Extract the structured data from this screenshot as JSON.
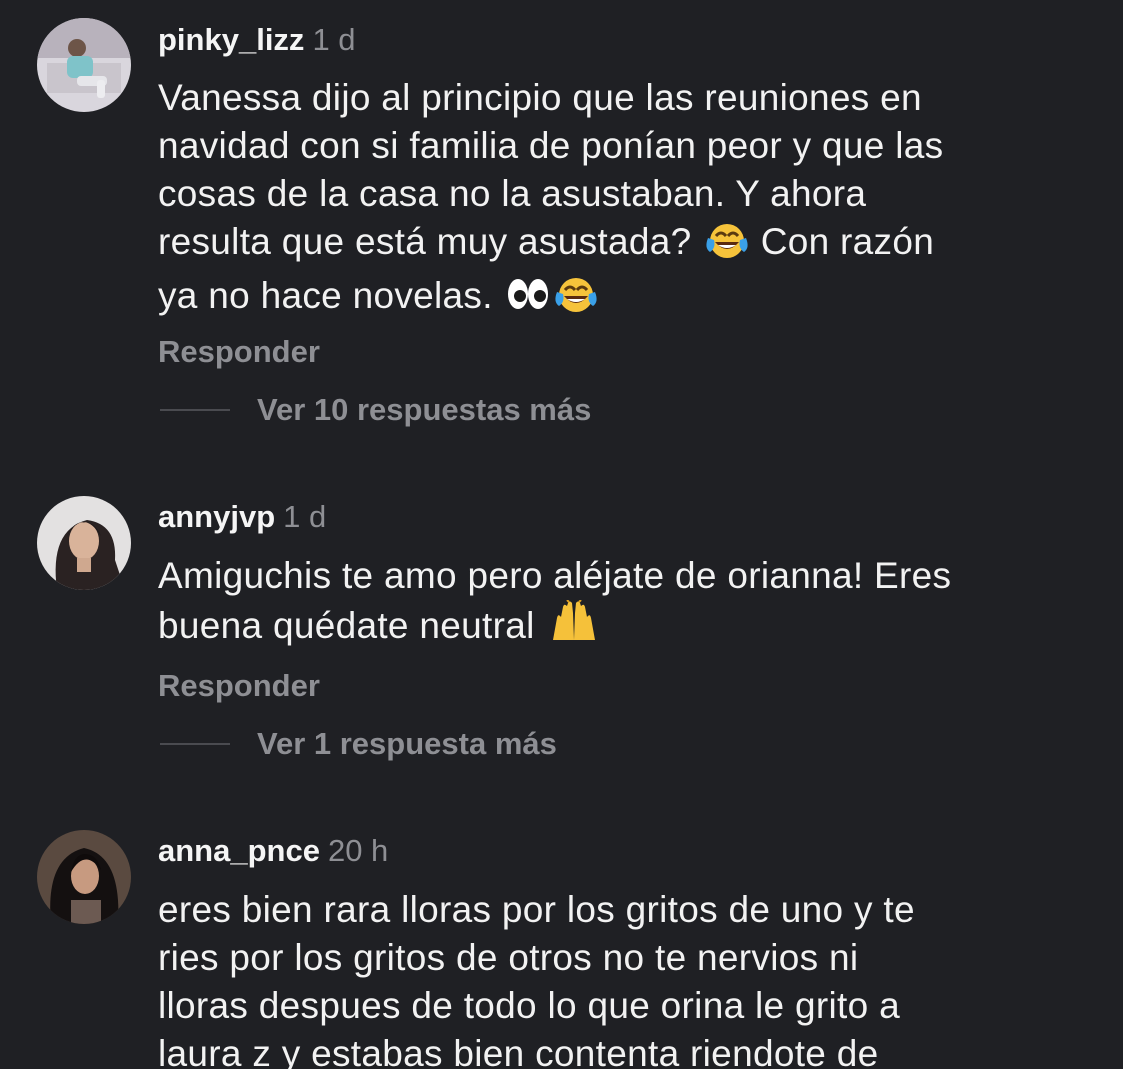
{
  "comments": [
    {
      "username": "pinky_lizz",
      "time": "1 d",
      "lines": [
        "Vanessa dijo al principio que las reuniones en",
        "navidad con si familia de ponían peor y que las",
        "cosas de la casa no la asustaban. Y ahora",
        "resulta que está muy asustada?",
        "Con razón",
        "ya no hace novelas."
      ],
      "reply_label": "Responder",
      "more_replies": "Ver 10 respuestas más"
    },
    {
      "username": "annyjvp",
      "time": "1 d",
      "lines": [
        "Amiguchis te amo pero aléjate de orianna! Eres",
        "buena quédate neutral"
      ],
      "reply_label": "Responder",
      "more_replies": "Ver 1 respuesta más"
    },
    {
      "username": "anna_pnce",
      "time": "20 h",
      "lines": [
        "eres bien rara lloras por los gritos de uno y te",
        "ries por los gritos de otros no te nervios ni",
        "lloras despues de todo lo que orina le grito a",
        "laura z y estabas bien contenta riendote de"
      ]
    }
  ],
  "icons": {
    "laugh": "face-with-tears-of-joy-icon",
    "eyes": "eyes-icon",
    "hands": "raising-hands-icon"
  },
  "colors": {
    "background": "#1f2024",
    "text": "#f2f2f2",
    "muted": "#8e8f94"
  }
}
